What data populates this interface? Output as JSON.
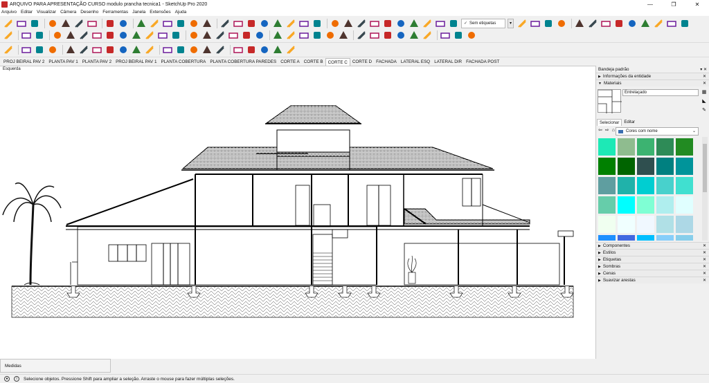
{
  "window": {
    "title": "ARQUIVO PARA APRESENTAÇÃO CURSO modulo prancha tecnica1 - SketchUp Pro 2020"
  },
  "window_controls": {
    "minimize": "—",
    "maximize": "❐",
    "close": "✕"
  },
  "menu": [
    "Arquivo",
    "Editar",
    "Visualizar",
    "Câmera",
    "Desenho",
    "Ferramentas",
    "Janela",
    "Extensões",
    "Ajuda"
  ],
  "toolbar": {
    "row1_icons": [
      "select-tool-icon",
      "open-file-icon",
      "save-icon",
      "cut-icon",
      "copy-icon",
      "paste-icon",
      "erase-icon",
      "undo-icon",
      "redo-icon",
      "print-icon",
      "model-info-icon",
      "components-icon",
      "home-icon",
      "3d-warehouse-icon",
      "extension-warehouse-icon",
      "share-model-icon",
      "xray-icon",
      "back-edges-icon",
      "wireframe-icon",
      "hidden-line-icon",
      "shaded-icon",
      "textured-icon",
      "monochrome-icon",
      "iso-view-icon",
      "top-view-icon",
      "front-view-icon",
      "right-view-icon",
      "back-view-icon",
      "left-view-icon",
      "bottom-view-icon",
      "undo-view-icon",
      "eye-icon",
      "footprint-icon"
    ],
    "tag_select": "Sem etiquetas",
    "row1_right_icons": [
      "section-plane-icon",
      "display-section-icon",
      "section-cut-icon",
      "section-fill-icon",
      "sandbox-icon",
      "smoove-icon",
      "stamp-icon",
      "drape-icon",
      "add-detail-icon",
      "flip-edge-icon",
      "position-camera-icon",
      "walk-icon",
      "look-around-icon"
    ],
    "row2_icons": [
      "select-arrow-icon",
      "paint-bucket-icon",
      "eraser-icon",
      "line-icon",
      "freehand-icon",
      "rectangle-icon",
      "rotated-rectangle-icon",
      "circle-icon",
      "polygon-icon",
      "arc-icon",
      "two-point-arc-icon",
      "three-point-arc-icon",
      "pie-icon",
      "move-icon",
      "push-pull-icon",
      "rotate-icon",
      "follow-me-icon",
      "scale-icon",
      "offset-icon",
      "tape-measure-icon",
      "dimension-icon",
      "protractor-icon",
      "text-icon",
      "axes-icon",
      "3d-text-icon",
      "orbit-icon",
      "pan-icon",
      "zoom-icon",
      "zoom-window-icon",
      "zoom-extents-icon",
      "previous-view-icon",
      "position-camera-icon",
      "walk-icon",
      "look-around-icon"
    ],
    "row3_icons": [
      "select-arrow-icon",
      "eraser-icon",
      "pencil-icon",
      "arc-dropdown-icon",
      "push-pull-icon",
      "move-icon",
      "rotate-icon",
      "scale-icon",
      "offset-icon",
      "tape-measure-icon",
      "text-icon",
      "paint-bucket-icon",
      "orbit-icon",
      "pan-icon",
      "zoom-icon",
      "zoom-extents-icon",
      "components-icon",
      "materials-icon",
      "styles-icon",
      "warehouse-icon",
      "user-icon"
    ]
  },
  "scene_tabs": [
    "PROJ BEIRAL PAV 2",
    "PLANTA PAV 1",
    "PLANTA PAV 2",
    "PROJ BEIRAL PAV 1",
    "PLANTA COBERTURA",
    "PLANTA COBERTURA PAREDES",
    "CORTE A",
    "CORTE B",
    "CORTE C",
    "CORTE D",
    "FACHADA",
    "LATERAL ESQ",
    "LATERAL DIR",
    "FACHADA POST"
  ],
  "active_tab": "CORTE C",
  "viewport": {
    "view_label": "Esquerda"
  },
  "tray": {
    "title": "Bandeja padrão",
    "controls": "▾ ✕",
    "entity_info": "Informações da entidade",
    "materials": "Materiais",
    "material_name": "Entrelaçado",
    "tabs": [
      "Selecionar",
      "Editar"
    ],
    "library": "Cores com nome",
    "swatches": [
      "#1de9b6",
      "#8fbc8f",
      "#3cb371",
      "#2e8b57",
      "#228b22",
      "#008000",
      "#006400",
      "#2f4f4f",
      "#008080",
      "#00949a",
      "#5f9ea0",
      "#20b2aa",
      "#00ced1",
      "#48d1cc",
      "#40e0d0",
      "#66cdaa",
      "#00ffff",
      "#7fffd4",
      "#afeeee",
      "#e0ffff",
      "#f0fff0",
      "#f0ffff",
      "#f0f8ff",
      "#b0e0e6",
      "#add8e6",
      "#1e90ff",
      "#4169e1",
      "#00bfff",
      "#87cefa",
      "#87ceeb"
    ],
    "panels": [
      "Componentes",
      "Estilos",
      "Etiquetas",
      "Sombras",
      "Cenas",
      "Suavizar arestas"
    ]
  },
  "measurements": {
    "label": "Medidas"
  },
  "status": {
    "text": "Selecione objetos. Pressione Shift para ampliar a seleção. Arraste o mouse para fazer múltiplas seleções."
  }
}
